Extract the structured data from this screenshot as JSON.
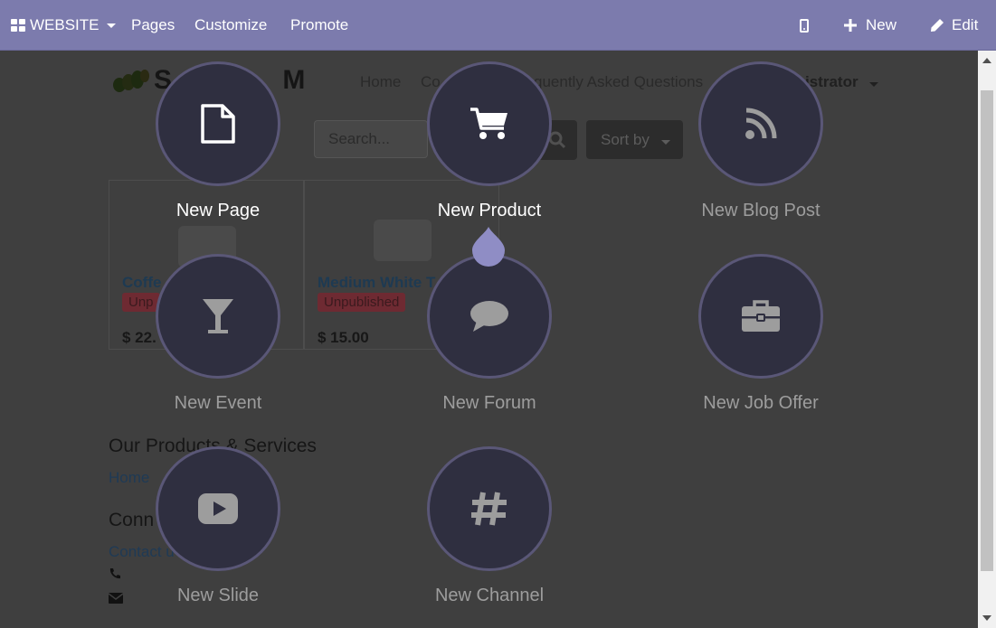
{
  "navbar": {
    "app_label": "WEBSITE",
    "menu": [
      "Pages",
      "Customize",
      "Promote"
    ],
    "new_label": "New",
    "edit_label": "Edit",
    "background_color": "#7c7bad"
  },
  "site": {
    "menu": [
      "Home",
      "Co",
      "quently Asked Questions",
      "istrator"
    ],
    "search_placeholder": "Search...",
    "sort_label": "Sort by",
    "products": [
      {
        "name": "Coffe",
        "badge": "Unp",
        "price": "$ 22."
      },
      {
        "name": "Medium White T",
        "badge": "Unpublished",
        "price": "$ 15.00"
      }
    ],
    "footer": {
      "heading1": "Our Products & Services",
      "link1": "Home",
      "heading2": "Conn",
      "link2": "Contact u"
    }
  },
  "new_content": {
    "options": [
      {
        "label": "New Page",
        "icon": "file-icon",
        "active": true
      },
      {
        "label": "New Product",
        "icon": "shopping-cart-icon",
        "active": true
      },
      {
        "label": "New Blog Post",
        "icon": "rss-icon",
        "active": false
      },
      {
        "label": "New Event",
        "icon": "glass-icon",
        "active": false
      },
      {
        "label": "New Forum",
        "icon": "comment-icon",
        "active": false
      },
      {
        "label": "New Job Offer",
        "icon": "briefcase-icon",
        "active": false
      },
      {
        "label": "New Slide",
        "icon": "youtube-play-icon",
        "active": false
      },
      {
        "label": "New Channel",
        "icon": "hashtag-icon",
        "active": false
      }
    ],
    "accent_color": "#8f8dc5"
  }
}
